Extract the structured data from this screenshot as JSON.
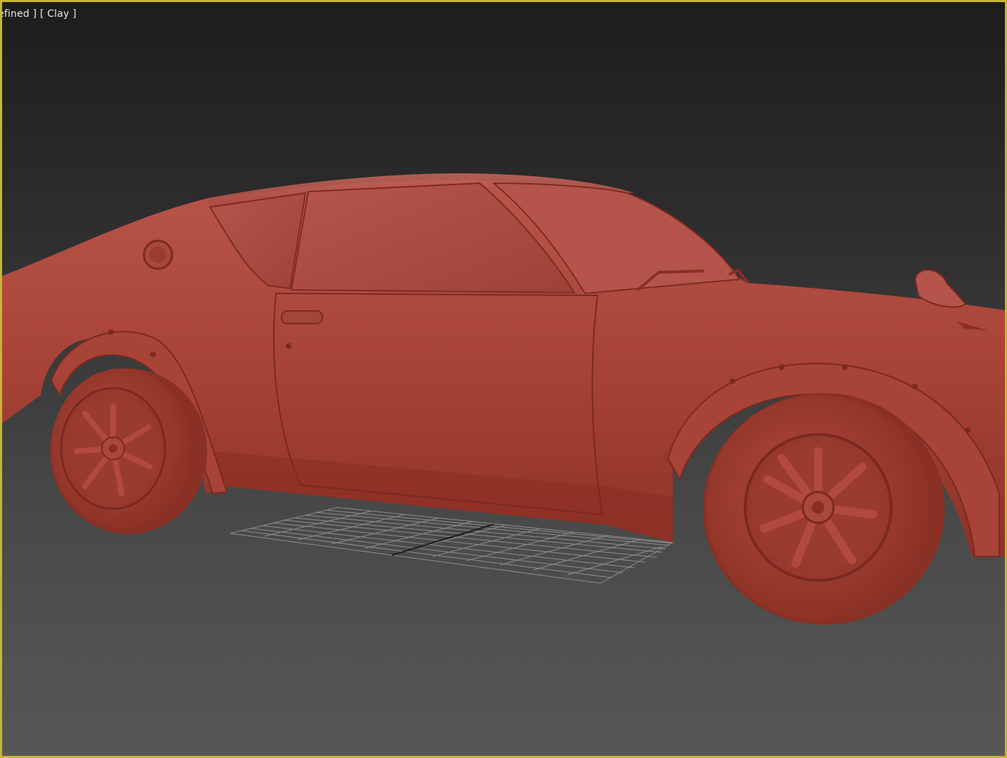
{
  "viewport": {
    "label_user_defined": "efined ]",
    "label_shading": "[ Clay ]",
    "border_color": "#c8b536"
  },
  "scene": {
    "object": "car-body",
    "material_color": "#b24a3e",
    "shading_mode": "Clay"
  },
  "icons": {
    "grid": "grid-icon",
    "car": "car-icon"
  }
}
